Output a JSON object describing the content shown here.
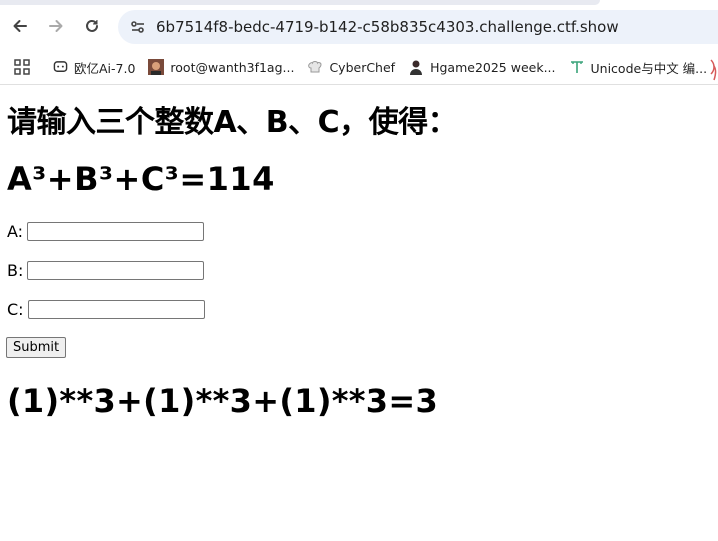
{
  "browser": {
    "url": "6b7514f8-bedc-4719-b142-c58b835c4303.challenge.ctf.show",
    "bookmarks": [
      {
        "label": "欧亿Ai-7.0",
        "icon": "chat-bubble-icon"
      },
      {
        "label": "root@wanth3f1ag...",
        "icon": "avatar-photo-icon"
      },
      {
        "label": "CyberChef",
        "icon": "chef-hat-icon"
      },
      {
        "label": "Hgame2025 week...",
        "icon": "avatar-person-icon"
      },
      {
        "label": "Unicode与中文 编...",
        "icon": "font-t-icon"
      }
    ]
  },
  "page": {
    "title": "请输入三个整数A、B、C，使得：",
    "equation": "A³+B³+C³=114",
    "fields": [
      {
        "label": "A:",
        "value": ""
      },
      {
        "label": "B:",
        "value": ""
      },
      {
        "label": "C:",
        "value": ""
      }
    ],
    "submit_label": "Submit",
    "result": "(1)**3+(1)**3+(1)**3=3"
  },
  "colors": {
    "omnibox_bg": "#edf2fa",
    "text": "#000000"
  }
}
